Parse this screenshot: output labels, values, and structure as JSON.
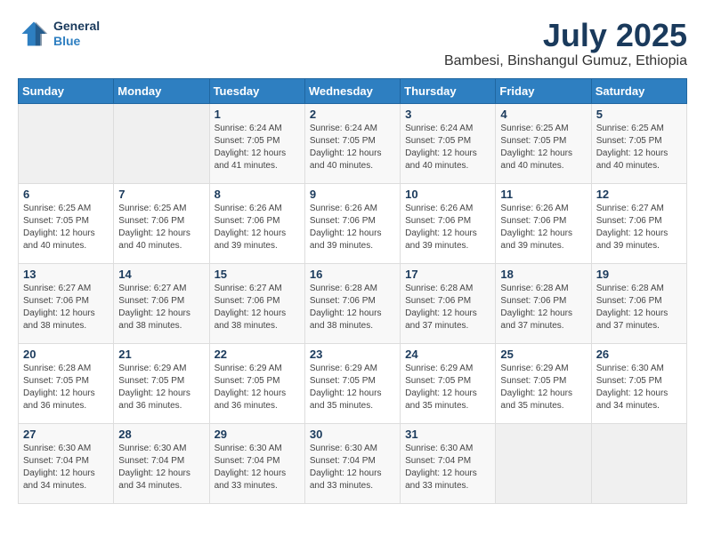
{
  "header": {
    "logo": {
      "line1": "General",
      "line2": "Blue"
    },
    "month": "July 2025",
    "location": "Bambesi, Binshangul Gumuz, Ethiopia"
  },
  "weekdays": [
    "Sunday",
    "Monday",
    "Tuesday",
    "Wednesday",
    "Thursday",
    "Friday",
    "Saturday"
  ],
  "weeks": [
    [
      {
        "day": "",
        "sunrise": "",
        "sunset": "",
        "daylight": ""
      },
      {
        "day": "",
        "sunrise": "",
        "sunset": "",
        "daylight": ""
      },
      {
        "day": "1",
        "sunrise": "Sunrise: 6:24 AM",
        "sunset": "Sunset: 7:05 PM",
        "daylight": "Daylight: 12 hours and 41 minutes."
      },
      {
        "day": "2",
        "sunrise": "Sunrise: 6:24 AM",
        "sunset": "Sunset: 7:05 PM",
        "daylight": "Daylight: 12 hours and 40 minutes."
      },
      {
        "day": "3",
        "sunrise": "Sunrise: 6:24 AM",
        "sunset": "Sunset: 7:05 PM",
        "daylight": "Daylight: 12 hours and 40 minutes."
      },
      {
        "day": "4",
        "sunrise": "Sunrise: 6:25 AM",
        "sunset": "Sunset: 7:05 PM",
        "daylight": "Daylight: 12 hours and 40 minutes."
      },
      {
        "day": "5",
        "sunrise": "Sunrise: 6:25 AM",
        "sunset": "Sunset: 7:05 PM",
        "daylight": "Daylight: 12 hours and 40 minutes."
      }
    ],
    [
      {
        "day": "6",
        "sunrise": "Sunrise: 6:25 AM",
        "sunset": "Sunset: 7:05 PM",
        "daylight": "Daylight: 12 hours and 40 minutes."
      },
      {
        "day": "7",
        "sunrise": "Sunrise: 6:25 AM",
        "sunset": "Sunset: 7:06 PM",
        "daylight": "Daylight: 12 hours and 40 minutes."
      },
      {
        "day": "8",
        "sunrise": "Sunrise: 6:26 AM",
        "sunset": "Sunset: 7:06 PM",
        "daylight": "Daylight: 12 hours and 39 minutes."
      },
      {
        "day": "9",
        "sunrise": "Sunrise: 6:26 AM",
        "sunset": "Sunset: 7:06 PM",
        "daylight": "Daylight: 12 hours and 39 minutes."
      },
      {
        "day": "10",
        "sunrise": "Sunrise: 6:26 AM",
        "sunset": "Sunset: 7:06 PM",
        "daylight": "Daylight: 12 hours and 39 minutes."
      },
      {
        "day": "11",
        "sunrise": "Sunrise: 6:26 AM",
        "sunset": "Sunset: 7:06 PM",
        "daylight": "Daylight: 12 hours and 39 minutes."
      },
      {
        "day": "12",
        "sunrise": "Sunrise: 6:27 AM",
        "sunset": "Sunset: 7:06 PM",
        "daylight": "Daylight: 12 hours and 39 minutes."
      }
    ],
    [
      {
        "day": "13",
        "sunrise": "Sunrise: 6:27 AM",
        "sunset": "Sunset: 7:06 PM",
        "daylight": "Daylight: 12 hours and 38 minutes."
      },
      {
        "day": "14",
        "sunrise": "Sunrise: 6:27 AM",
        "sunset": "Sunset: 7:06 PM",
        "daylight": "Daylight: 12 hours and 38 minutes."
      },
      {
        "day": "15",
        "sunrise": "Sunrise: 6:27 AM",
        "sunset": "Sunset: 7:06 PM",
        "daylight": "Daylight: 12 hours and 38 minutes."
      },
      {
        "day": "16",
        "sunrise": "Sunrise: 6:28 AM",
        "sunset": "Sunset: 7:06 PM",
        "daylight": "Daylight: 12 hours and 38 minutes."
      },
      {
        "day": "17",
        "sunrise": "Sunrise: 6:28 AM",
        "sunset": "Sunset: 7:06 PM",
        "daylight": "Daylight: 12 hours and 37 minutes."
      },
      {
        "day": "18",
        "sunrise": "Sunrise: 6:28 AM",
        "sunset": "Sunset: 7:06 PM",
        "daylight": "Daylight: 12 hours and 37 minutes."
      },
      {
        "day": "19",
        "sunrise": "Sunrise: 6:28 AM",
        "sunset": "Sunset: 7:06 PM",
        "daylight": "Daylight: 12 hours and 37 minutes."
      }
    ],
    [
      {
        "day": "20",
        "sunrise": "Sunrise: 6:28 AM",
        "sunset": "Sunset: 7:05 PM",
        "daylight": "Daylight: 12 hours and 36 minutes."
      },
      {
        "day": "21",
        "sunrise": "Sunrise: 6:29 AM",
        "sunset": "Sunset: 7:05 PM",
        "daylight": "Daylight: 12 hours and 36 minutes."
      },
      {
        "day": "22",
        "sunrise": "Sunrise: 6:29 AM",
        "sunset": "Sunset: 7:05 PM",
        "daylight": "Daylight: 12 hours and 36 minutes."
      },
      {
        "day": "23",
        "sunrise": "Sunrise: 6:29 AM",
        "sunset": "Sunset: 7:05 PM",
        "daylight": "Daylight: 12 hours and 35 minutes."
      },
      {
        "day": "24",
        "sunrise": "Sunrise: 6:29 AM",
        "sunset": "Sunset: 7:05 PM",
        "daylight": "Daylight: 12 hours and 35 minutes."
      },
      {
        "day": "25",
        "sunrise": "Sunrise: 6:29 AM",
        "sunset": "Sunset: 7:05 PM",
        "daylight": "Daylight: 12 hours and 35 minutes."
      },
      {
        "day": "26",
        "sunrise": "Sunrise: 6:30 AM",
        "sunset": "Sunset: 7:05 PM",
        "daylight": "Daylight: 12 hours and 34 minutes."
      }
    ],
    [
      {
        "day": "27",
        "sunrise": "Sunrise: 6:30 AM",
        "sunset": "Sunset: 7:04 PM",
        "daylight": "Daylight: 12 hours and 34 minutes."
      },
      {
        "day": "28",
        "sunrise": "Sunrise: 6:30 AM",
        "sunset": "Sunset: 7:04 PM",
        "daylight": "Daylight: 12 hours and 34 minutes."
      },
      {
        "day": "29",
        "sunrise": "Sunrise: 6:30 AM",
        "sunset": "Sunset: 7:04 PM",
        "daylight": "Daylight: 12 hours and 33 minutes."
      },
      {
        "day": "30",
        "sunrise": "Sunrise: 6:30 AM",
        "sunset": "Sunset: 7:04 PM",
        "daylight": "Daylight: 12 hours and 33 minutes."
      },
      {
        "day": "31",
        "sunrise": "Sunrise: 6:30 AM",
        "sunset": "Sunset: 7:04 PM",
        "daylight": "Daylight: 12 hours and 33 minutes."
      },
      {
        "day": "",
        "sunrise": "",
        "sunset": "",
        "daylight": ""
      },
      {
        "day": "",
        "sunrise": "",
        "sunset": "",
        "daylight": ""
      }
    ]
  ]
}
